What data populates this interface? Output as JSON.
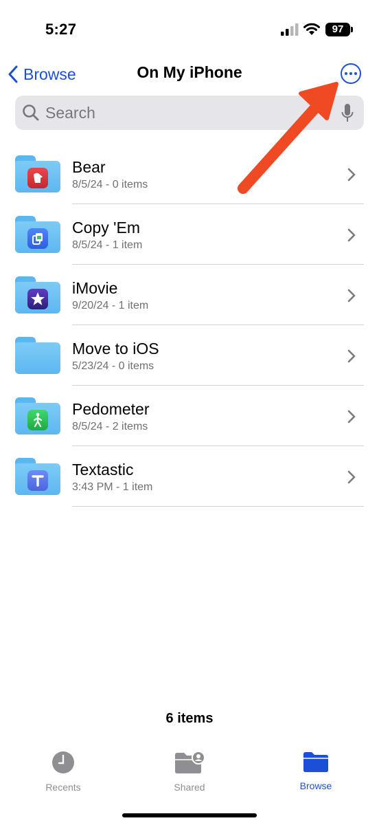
{
  "status_bar": {
    "time": "5:27",
    "battery": "97"
  },
  "nav": {
    "back_label": "Browse",
    "title": "On My iPhone"
  },
  "search": {
    "placeholder": "Search"
  },
  "files": [
    {
      "name": "Bear",
      "meta": "8/5/24 - 0 items",
      "icon": "bear-app-icon"
    },
    {
      "name": "Copy 'Em",
      "meta": "8/5/24 - 1 item",
      "icon": "copy-em-app-icon"
    },
    {
      "name": "iMovie",
      "meta": "9/20/24 - 1 item",
      "icon": "imovie-star-icon"
    },
    {
      "name": "Move to iOS",
      "meta": "5/23/24 - 0 items",
      "icon": "plain-folder-icon"
    },
    {
      "name": "Pedometer",
      "meta": "8/5/24 - 2 items",
      "icon": "pedometer-walker-icon"
    },
    {
      "name": "Textastic",
      "meta": "3:43 PM - 1 item",
      "icon": "textastic-t-icon"
    }
  ],
  "footer": {
    "item_count": "6 items"
  },
  "tabs": [
    {
      "label": "Recents",
      "icon": "clock-icon",
      "active": false
    },
    {
      "label": "Shared",
      "icon": "shared-folder-icon",
      "active": false
    },
    {
      "label": "Browse",
      "icon": "folder-icon",
      "active": true
    }
  ],
  "colors": {
    "accent": "#1c4fd8",
    "annotation_arrow": "#f04a25",
    "folder": "#6cc0f4"
  }
}
